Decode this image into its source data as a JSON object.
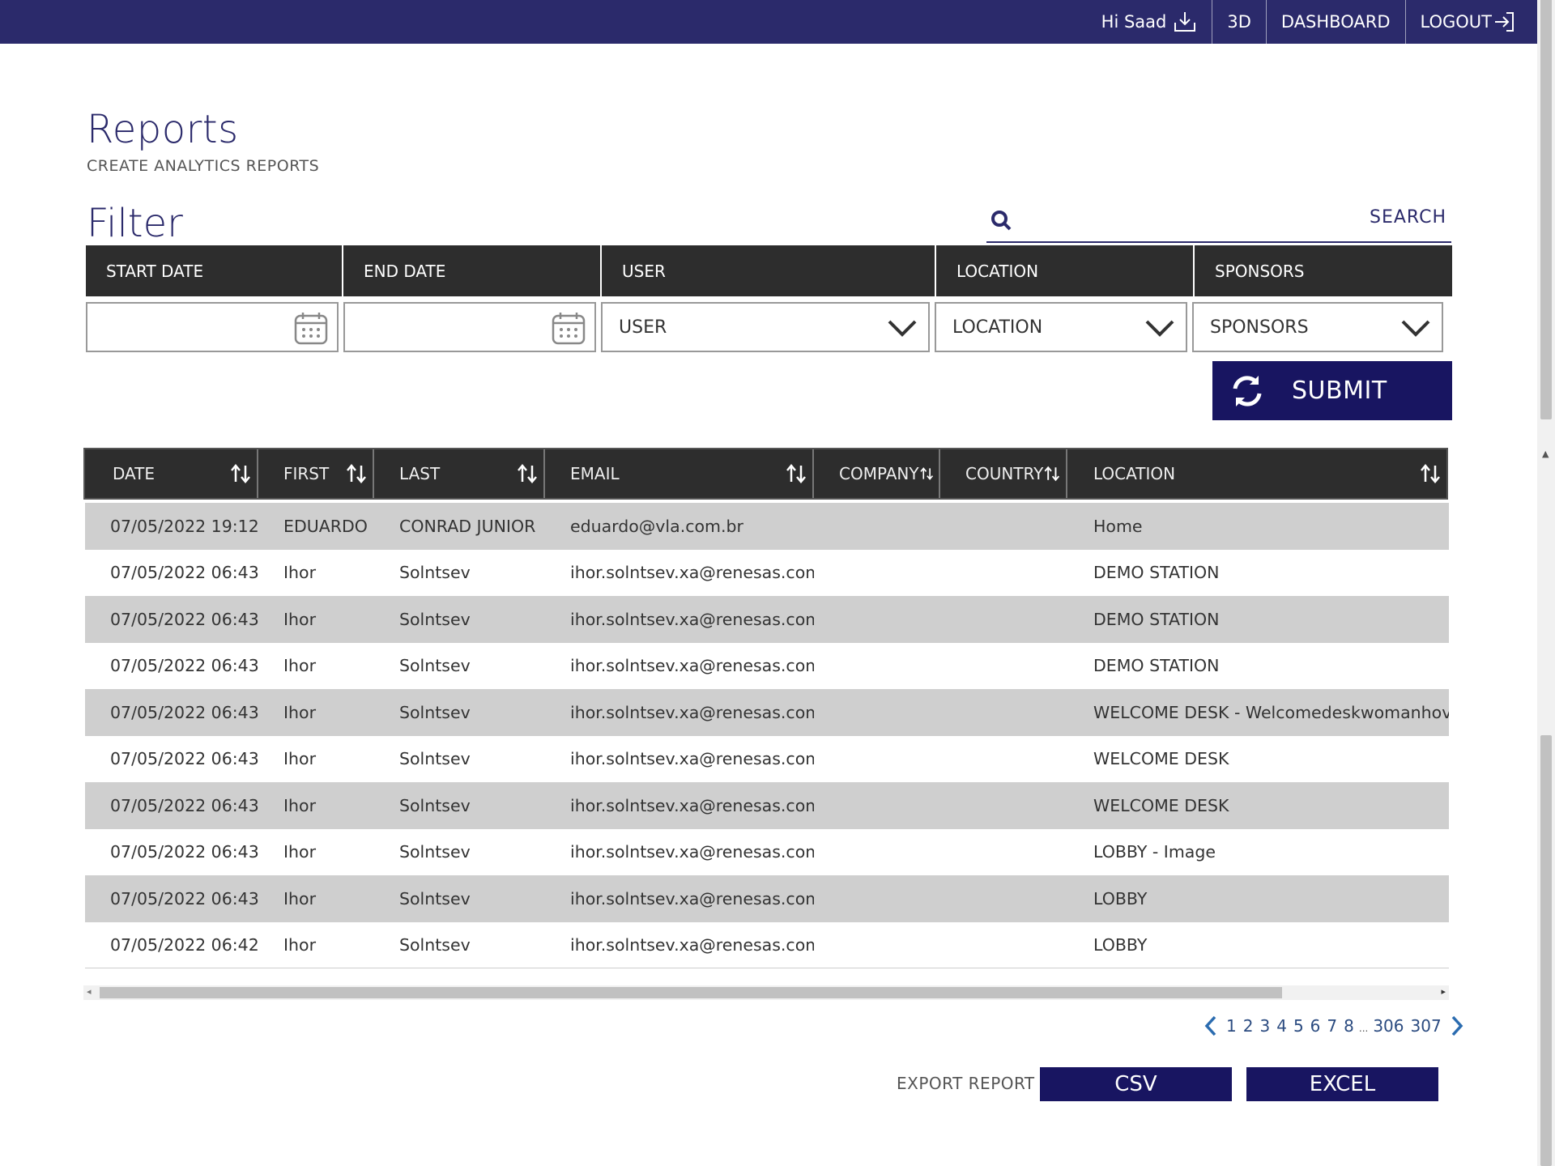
{
  "header": {
    "greeting": "Hi Saad",
    "nav": [
      "3D",
      "DASHBOARD",
      "LOGOUT"
    ]
  },
  "page": {
    "title": "Reports",
    "subtitle": "CREATE ANALYTICS REPORTS"
  },
  "filter": {
    "title": "Filter",
    "search_label": "SEARCH",
    "columns": [
      "START DATE",
      "END DATE",
      "USER",
      "LOCATION",
      "SPONSORS"
    ],
    "user_value": "USER",
    "location_value": "LOCATION",
    "sponsors_value": "SPONSORS",
    "submit_label": "SUBMIT"
  },
  "table": {
    "columns": [
      "DATE",
      "FIRST",
      "LAST",
      "EMAIL",
      "COMPANY",
      "COUNTRY",
      "LOCATION"
    ],
    "rows": [
      [
        "07/05/2022 19:12",
        "EDUARDO",
        "CONRAD JUNIOR",
        "eduardo@vla.com.br",
        "",
        "",
        "Home"
      ],
      [
        "07/05/2022 06:43",
        "Ihor",
        "Solntsev",
        "ihor.solntsev.xa@renesas.com",
        "",
        "",
        "DEMO STATION"
      ],
      [
        "07/05/2022 06:43",
        "Ihor",
        "Solntsev",
        "ihor.solntsev.xa@renesas.com",
        "",
        "",
        "DEMO STATION"
      ],
      [
        "07/05/2022 06:43",
        "Ihor",
        "Solntsev",
        "ihor.solntsev.xa@renesas.com",
        "",
        "",
        "DEMO STATION"
      ],
      [
        "07/05/2022 06:43",
        "Ihor",
        "Solntsev",
        "ihor.solntsev.xa@renesas.com",
        "",
        "",
        "WELCOME DESK - Welcomedeskwomanhover"
      ],
      [
        "07/05/2022 06:43",
        "Ihor",
        "Solntsev",
        "ihor.solntsev.xa@renesas.com",
        "",
        "",
        "WELCOME DESK"
      ],
      [
        "07/05/2022 06:43",
        "Ihor",
        "Solntsev",
        "ihor.solntsev.xa@renesas.com",
        "",
        "",
        "WELCOME DESK"
      ],
      [
        "07/05/2022 06:43",
        "Ihor",
        "Solntsev",
        "ihor.solntsev.xa@renesas.com",
        "",
        "",
        "LOBBY - Image"
      ],
      [
        "07/05/2022 06:43",
        "Ihor",
        "Solntsev",
        "ihor.solntsev.xa@renesas.com",
        "",
        "",
        "LOBBY"
      ],
      [
        "07/05/2022 06:42",
        "Ihor",
        "Solntsev",
        "ihor.solntsev.xa@renesas.com",
        "",
        "",
        "LOBBY"
      ]
    ]
  },
  "pagination": {
    "pages": [
      "1",
      "2",
      "3",
      "4",
      "5",
      "6",
      "7",
      "8"
    ],
    "ellipsis": "...",
    "last_pages": [
      "306",
      "307"
    ]
  },
  "export": {
    "label": "EXPORT REPORT",
    "csv": "CSV",
    "excel": "EXCEL"
  },
  "colors": {
    "navy": "#2b2a6b",
    "button_navy": "#181561",
    "header_dark": "#2d2d2d",
    "row_gray": "#cfcfcf"
  }
}
